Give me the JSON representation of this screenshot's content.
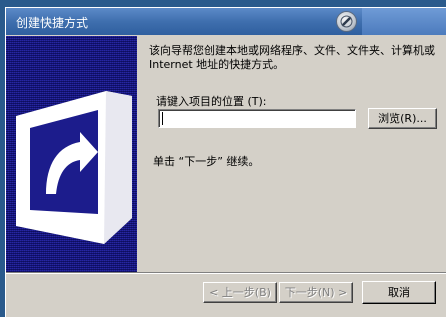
{
  "window": {
    "title": "创建快捷方式"
  },
  "titlebar": {
    "help_icon": "help-icon",
    "close_icon": "close-icon"
  },
  "panel": {
    "image_icon": "shortcut-arrow-icon"
  },
  "content": {
    "description": "该向导帮您创建本地或网络程序、文件、文件夹、计算机或 Internet 地址的快捷方式。",
    "location_label": "请键入项目的位置 (T):",
    "location_value": "",
    "browse_label": "浏览(R)...",
    "continue_text": "单击 “下一步” 继续。"
  },
  "footer": {
    "back_label": "< 上一步(B)",
    "next_label": "下一步(N) >",
    "cancel_label": "取消"
  },
  "colors": {
    "titlebar": "#3f6fae",
    "panel": "#1c1c8c",
    "window": "#d4d0c8"
  }
}
